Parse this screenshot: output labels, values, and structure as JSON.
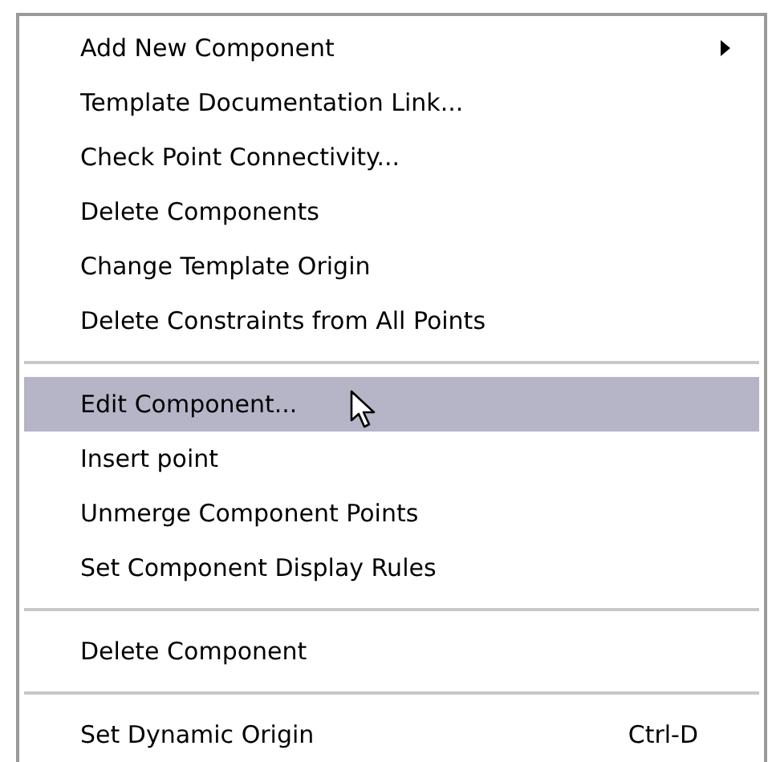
{
  "context_menu": {
    "entries": [
      {
        "kind": "item",
        "label": "Add New Component",
        "selected": false,
        "submenu": true
      },
      {
        "kind": "item",
        "label": "Template Documentation Link...",
        "selected": false
      },
      {
        "kind": "item",
        "label": "Check Point Connectivity...",
        "selected": false
      },
      {
        "kind": "item",
        "label": "Delete Components",
        "selected": false
      },
      {
        "kind": "item",
        "label": "Change Template Origin",
        "selected": false
      },
      {
        "kind": "item",
        "label": "Delete Constraints from All Points",
        "selected": false
      },
      {
        "kind": "separator"
      },
      {
        "kind": "item",
        "label": "Edit Component...",
        "selected": true,
        "pointer": true
      },
      {
        "kind": "item",
        "label": "Insert point",
        "selected": false
      },
      {
        "kind": "item",
        "label": "Unmerge Component Points",
        "selected": false
      },
      {
        "kind": "item",
        "label": "Set Component Display Rules",
        "selected": false
      },
      {
        "kind": "separator"
      },
      {
        "kind": "item",
        "label": "Delete Component",
        "selected": false
      },
      {
        "kind": "separator"
      },
      {
        "kind": "item",
        "label": "Set Dynamic Origin",
        "selected": false,
        "shortcut": "Ctrl-D"
      }
    ]
  }
}
